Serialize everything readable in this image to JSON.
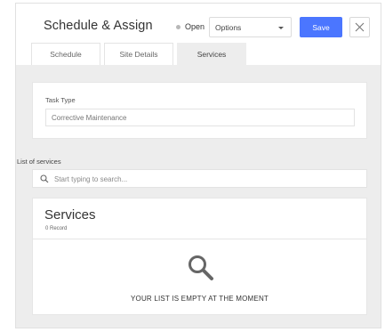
{
  "header": {
    "title": "Schedule & Assign",
    "status_label": "Open",
    "status_color": "#b8b8b8",
    "options_select": {
      "selected": "Options"
    },
    "save_label": "Save",
    "close_icon": "close-icon"
  },
  "tabs": [
    {
      "label": "Schedule",
      "active": false
    },
    {
      "label": "Site Details",
      "active": false
    },
    {
      "label": "Services",
      "active": true
    }
  ],
  "task_type": {
    "label": "Task Type",
    "value": "Corrective Maintenance"
  },
  "services_list": {
    "label": "List of services",
    "search_placeholder": "Start typing to search...",
    "search_icon": "search-icon"
  },
  "services_card": {
    "title": "Services",
    "count": "0 Record",
    "empty_icon": "magnifier-icon",
    "empty_message": "YOUR LIST IS EMPTY AT THE MOMENT"
  },
  "colors": {
    "accent": "#4b76ff",
    "panel_bg": "#ededed"
  }
}
